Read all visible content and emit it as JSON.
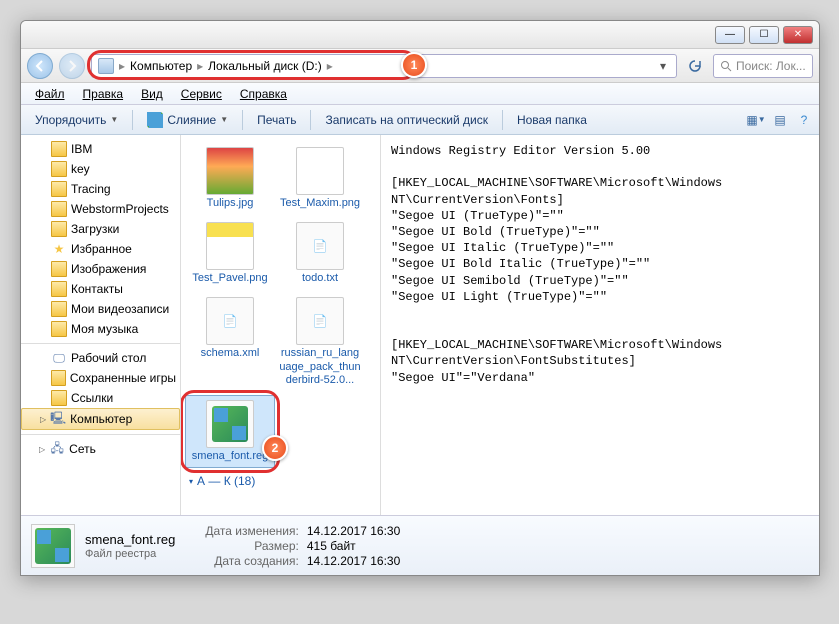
{
  "breadcrumb": {
    "root": "Компьютер",
    "drive": "Локальный диск (D:)"
  },
  "search": {
    "placeholder": "Поиск: Лок..."
  },
  "menubar": {
    "file": "Файл",
    "edit": "Правка",
    "view": "Вид",
    "tools": "Сервис",
    "help": "Справка"
  },
  "toolbar": {
    "organize": "Упорядочить",
    "merge": "Слияние",
    "print": "Печать",
    "burn": "Записать на оптический диск",
    "newfolder": "Новая папка"
  },
  "sidebar": {
    "items": [
      "IBM",
      "key",
      "Tracing",
      "WebstormProjects",
      "Загрузки",
      "Избранное",
      "Изображения",
      "Контакты",
      "Мои видеозаписи",
      "Моя музыка",
      "---",
      "Рабочий стол",
      "Сохраненные игры",
      "Ссылки"
    ],
    "computer": "Компьютер",
    "network": "Сеть"
  },
  "files": {
    "tulips": "Tulips.jpg",
    "testmax": "Test_Maxim.png",
    "testpavel": "Test_Pavel.png",
    "todo": "todo.txt",
    "schema": "schema.xml",
    "russian": "russian_ru_language_pack_thunderbird-52.0...",
    "smena": "smena_font.reg",
    "group": "А — К (18)"
  },
  "preview": "Windows Registry Editor Version 5.00\n\n[HKEY_LOCAL_MACHINE\\SOFTWARE\\Microsoft\\Windows NT\\CurrentVersion\\Fonts]\n\"Segoe UI (TrueType)\"=\"\"\n\"Segoe UI Bold (TrueType)\"=\"\"\n\"Segoe UI Italic (TrueType)\"=\"\"\n\"Segoe UI Bold Italic (TrueType)\"=\"\"\n\"Segoe UI Semibold (TrueType)\"=\"\"\n\"Segoe UI Light (TrueType)\"=\"\"\n\n\n[HKEY_LOCAL_MACHINE\\SOFTWARE\\Microsoft\\Windows NT\\CurrentVersion\\FontSubstitutes]\n\"Segoe UI\"=\"Verdana\"",
  "details": {
    "name": "smena_font.reg",
    "type": "Файл реестра",
    "mod_lbl": "Дата изменения:",
    "mod_val": "14.12.2017 16:30",
    "size_lbl": "Размер:",
    "size_val": "415 байт",
    "created_lbl": "Дата создания:",
    "created_val": "14.12.2017 16:30"
  },
  "callouts": {
    "one": "1",
    "two": "2"
  }
}
